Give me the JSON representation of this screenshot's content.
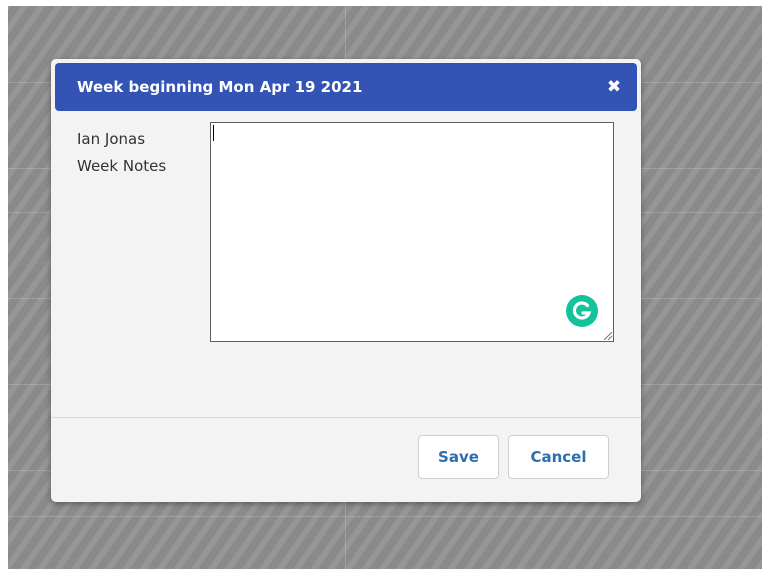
{
  "modal": {
    "title": "Week beginning Mon Apr 19 2021",
    "close_glyph": "✖",
    "labels": {
      "name": "Ian Jonas",
      "notes": "Week Notes"
    },
    "notes": {
      "value": "",
      "placeholder": ""
    },
    "buttons": {
      "save_label": "Save",
      "cancel_label": "Cancel"
    }
  },
  "icons": {
    "close": "close-icon",
    "grammarly": "grammarly-icon",
    "resize": "resize-handle-icon"
  },
  "colors": {
    "header": "#3353b5",
    "button_text": "#2b6fae",
    "grammarly": "#15c39a",
    "backdrop": "#8a8a8a"
  }
}
